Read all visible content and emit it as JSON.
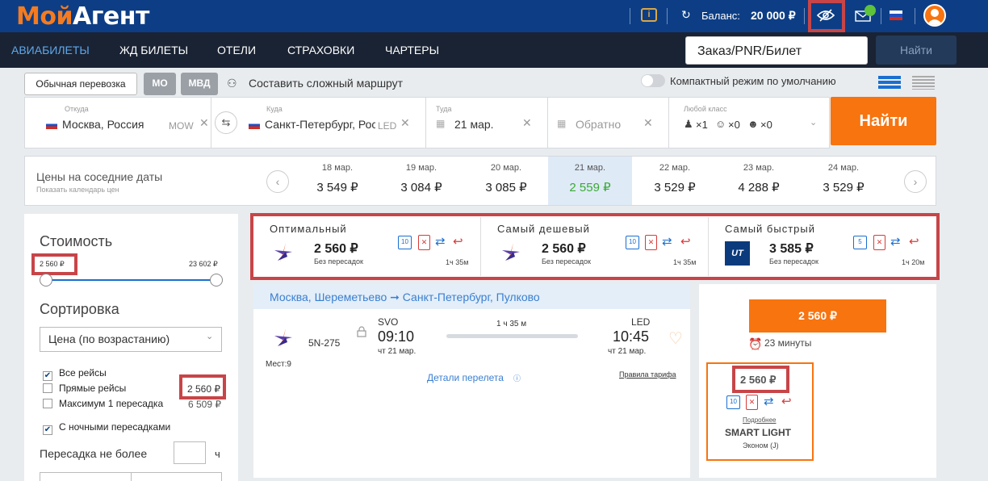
{
  "header": {
    "logo_part1": "Мой",
    "logo_part2": "Агент",
    "balance_label": "Баланс:",
    "balance_value": "20 000 ₽"
  },
  "nav": {
    "items": [
      "АВИАБИЛЕТЫ",
      "ЖД БИЛЕТЫ",
      "ОТЕЛИ",
      "СТРАХОВКИ",
      "ЧАРТЕРЫ"
    ],
    "pnr_value": "Заказ/PNR/Билет",
    "find_label": "Найти"
  },
  "options": {
    "transport_label": "Обычная перевозка",
    "mo_label": "МО",
    "mvd_label": "МВД",
    "complex_route_label": "Составить сложный маршрут",
    "compact_label": "Компактный режим по умолчанию"
  },
  "search": {
    "from_label": "Откуда",
    "from_value": "Москва, Россия",
    "from_code": "MOW",
    "to_label": "Куда",
    "to_value": "Санкт-Петербург, Россия",
    "to_code": "LED",
    "there_label": "Туда",
    "there_value": "21 мар.",
    "back_value": "Обратно",
    "class_label": "Любой класс",
    "adults": "×1",
    "children": "×0",
    "infants": "×0",
    "find_label": "Найти"
  },
  "dates": {
    "title": "Цены на соседние даты",
    "subtitle": "Показать календарь цен",
    "items": [
      {
        "date": "18 мар.",
        "price": "3 549 ₽"
      },
      {
        "date": "19 мар.",
        "price": "3 084 ₽"
      },
      {
        "date": "20 мар.",
        "price": "3 085 ₽"
      },
      {
        "date": "21 мар.",
        "price": "2 559 ₽"
      },
      {
        "date": "22 мар.",
        "price": "3 529 ₽"
      },
      {
        "date": "23 мар.",
        "price": "4 288 ₽"
      },
      {
        "date": "24 мар.",
        "price": "3 529 ₽"
      }
    ]
  },
  "filters": {
    "cost_title": "Стоимость",
    "cost_min": "2 560 ₽",
    "cost_max": "23 602 ₽",
    "sort_title": "Сортировка",
    "sort_value": "Цена (по возрастанию)",
    "all_flights": "Все рейсы",
    "direct": "Прямые рейсы",
    "direct_price": "2 560 ₽",
    "max1": "Максимум 1 пересадка",
    "max1_price": "6 509 ₽",
    "night": "С ночными пересадками",
    "transfer_label": "Пересадка не более",
    "transfer_unit": "ч"
  },
  "cards": [
    {
      "title": "Оптимальный",
      "price": "2 560 ₽",
      "sub": "Без пересадок",
      "dur": "1ч 35м",
      "bag": "10"
    },
    {
      "title": "Самый дешевый",
      "price": "2 560 ₽",
      "sub": "Без пересадок",
      "dur": "1ч 35м",
      "bag": "10"
    },
    {
      "title": "Самый быстрый",
      "price": "3 585 ₽",
      "sub": "Без пересадок",
      "dur": "1ч 20м",
      "bag": "5"
    }
  ],
  "flight": {
    "route": "Москва, Шереметьево ➞ Санкт-Петербург, Пулково",
    "number": "5N-275",
    "seats": "Мест:9",
    "dep_code": "SVO",
    "dep_time": "09:10",
    "dep_date": "чт 21 мар.",
    "duration": "1 ч 35 м",
    "arr_code": "LED",
    "arr_time": "10:45",
    "arr_date": "чт 21 мар.",
    "details": "Детали перелета",
    "rules": "Правила тарифа"
  },
  "offer": {
    "buy_price": "2 560 ₽",
    "timer": "23 минуты",
    "fare_price": "2 560 ₽",
    "more": "Подробнее",
    "fare_name": "SMART LIGHT",
    "fare_class": "Эконом (J)",
    "bag": "10"
  },
  "colors": {
    "brand_blue": "#0d3e85",
    "accent_orange": "#f7740f",
    "highlight_red": "#c74548",
    "link_blue": "#3a7fd0"
  }
}
